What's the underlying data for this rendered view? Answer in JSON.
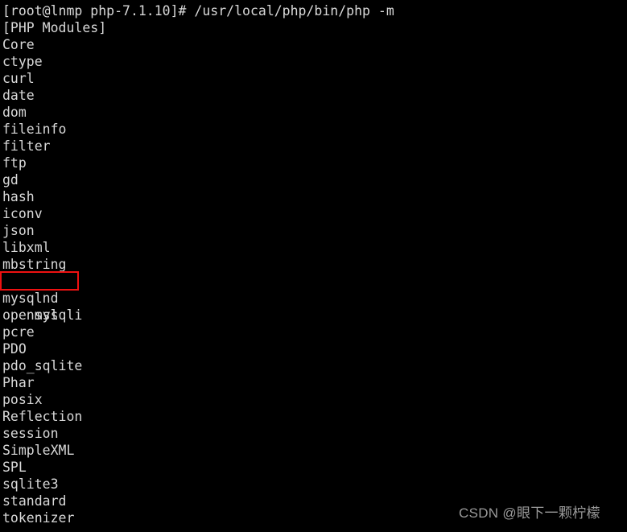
{
  "terminal": {
    "background_color": "#000000",
    "text_color": "#d8d8d8",
    "prompt_line": "[root@lnmp php-7.1.10]# /usr/local/php/bin/php -m",
    "section_header": "[PHP Modules]",
    "modules": [
      "Core",
      "ctype",
      "curl",
      "date",
      "dom",
      "fileinfo",
      "filter",
      "ftp",
      "gd",
      "hash",
      "iconv",
      "json",
      "libxml",
      "mbstring",
      "mysqli",
      "mysqlnd",
      "openssl",
      "pcre",
      "PDO",
      "pdo_sqlite",
      "Phar",
      "posix",
      "Reflection",
      "session",
      "SimpleXML",
      "SPL",
      "sqlite3",
      "standard",
      "tokenizer"
    ],
    "highlight": {
      "module": "mysqli",
      "index": 14,
      "color": "#ee1111"
    }
  },
  "watermark": {
    "text": "CSDN @眼下一颗柠檬",
    "color": "#9a9a9a"
  }
}
